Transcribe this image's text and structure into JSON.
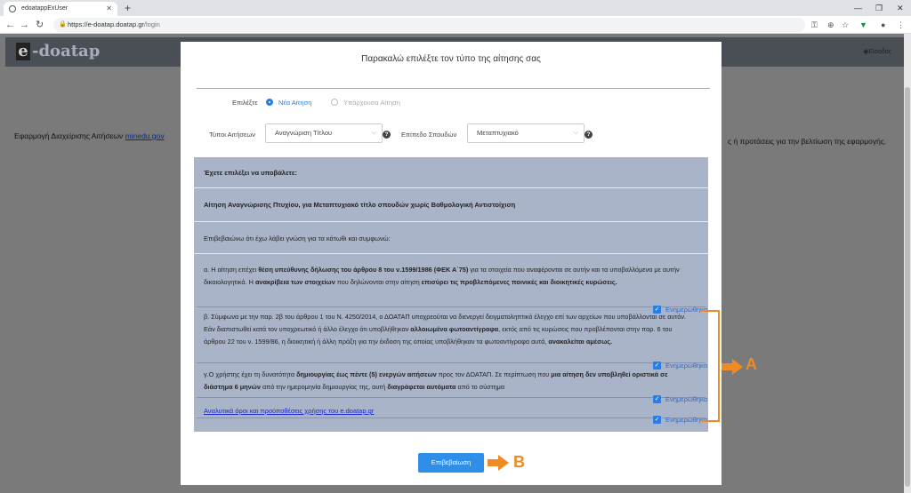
{
  "browser": {
    "tab_title": "edoatappExUser",
    "url_host": "https://e-doatap.doatap.gr",
    "url_path": "/login"
  },
  "background": {
    "logo_text": "-doatap",
    "logo_letter": "e",
    "login_label": "Είσοδος",
    "left_text": "Εφαρμογή Διαχείρισης Αιτήσεων",
    "left_link": "minedu.gov",
    "right_text": "ς ή προτάσεις για την βελτίωση της εφαρμογής."
  },
  "modal": {
    "title": "Παρακαλώ επιλέξτε τον τύπο της αίτησης σας",
    "choose_label": "Επιλέξτε",
    "radio_new": "Νέα Αίτηση",
    "radio_existing": "Υπάρχουσα Αίτηση",
    "types_label": "Τύποι Αιτήσεων",
    "types_value": "Αναγνώριση Τίτλου",
    "level_label": "Επίπεδο Σπουδών",
    "level_value": "Μεταπτυχιακό",
    "help_glyph": "?",
    "panel": {
      "heading": "Έχετε επιλέξει να υποβάλετε:",
      "application": "Αίτηση Αναγνώρισης Πτυχίου, για Μεταπτυχιακό τίτλο σπουδών χωρίς Βαθμολογική Αντιστοίχιση",
      "confirm_intro": "Επιβεβαιώνω ότι έχω λάβει γνώση για τα κάτωθι και συμφωνώ:",
      "terms_link": "Αναλυτικά όροι και προϋποθέσεις χρήσης του e.doatap.gr"
    },
    "checkbox_label": "Ενημερώθηκα",
    "confirm_button": "Επιβεβαίωση"
  },
  "annotations": {
    "a": "A",
    "b": "B",
    "color": "#f08a24"
  }
}
